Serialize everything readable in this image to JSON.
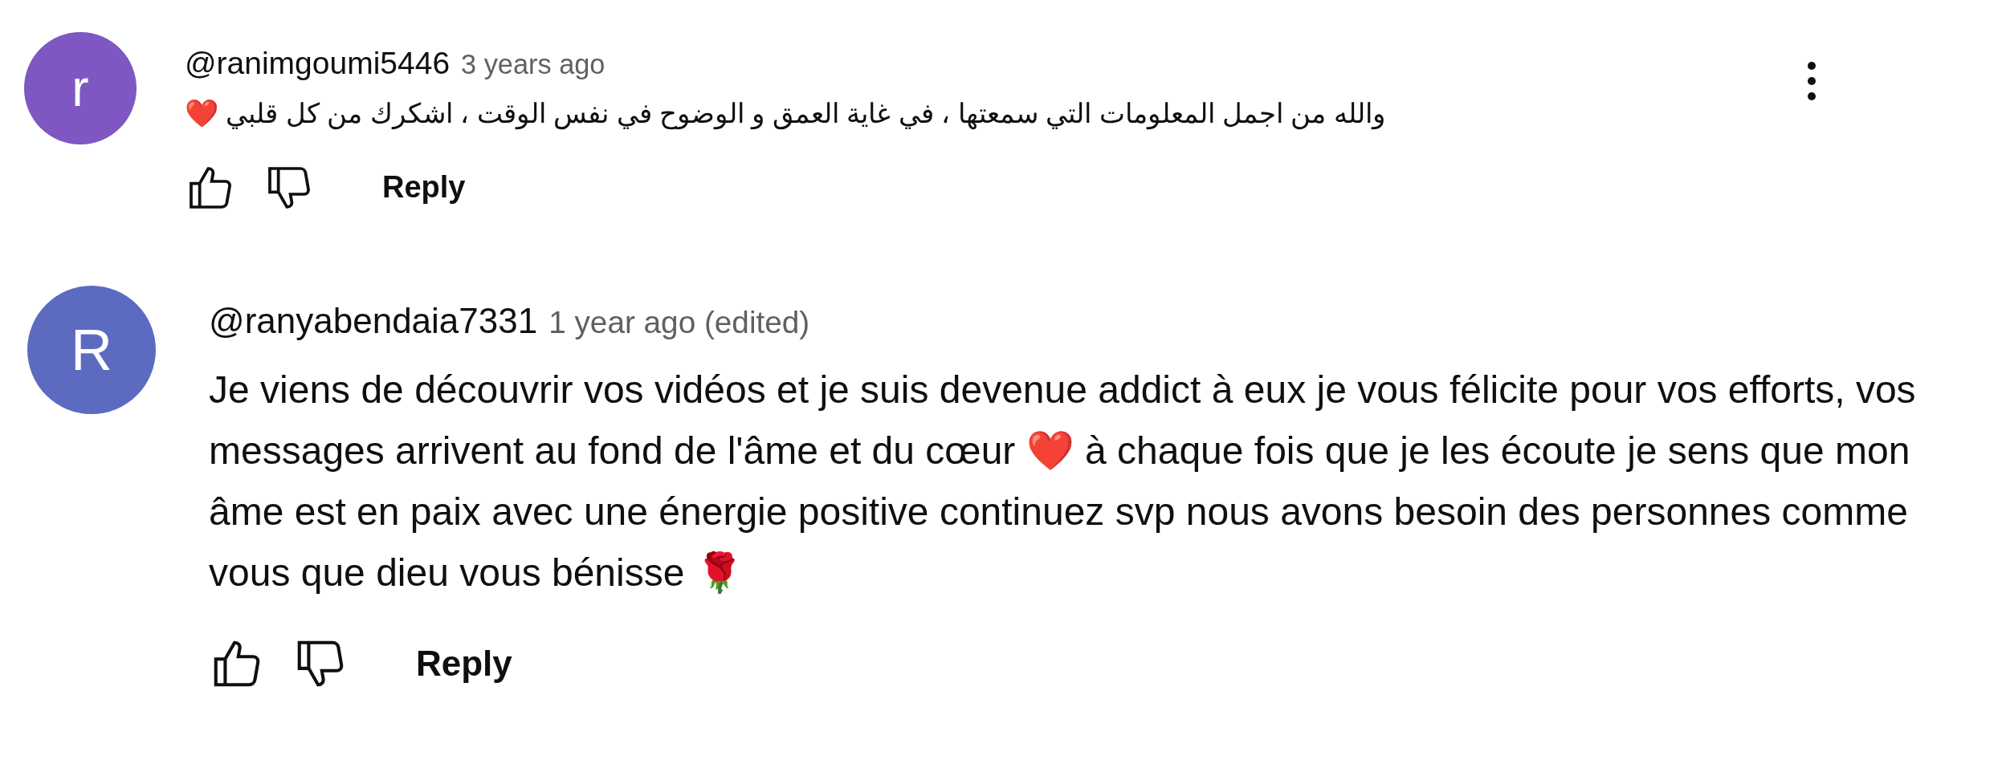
{
  "comments": [
    {
      "avatar_letter": "r",
      "color": "#7e57c2",
      "author": "@ranimgoumi5446",
      "time": "3 years ago",
      "text": "والله من اجمل المعلومات التي سمعتها ، في غاية العمق و الوضوح في نفس الوقت ، اشكرك من كل قلبي ❤️",
      "reply": "Reply",
      "kind": "compact",
      "menu": true
    },
    {
      "avatar_letter": "R",
      "color": "#5c6bc0",
      "author": "@ranyabendaia7331",
      "time": "1 year ago (edited)",
      "text": "Je viens de découvrir vos vidéos et je suis devenue addict à eux je vous félicite pour vos efforts, vos messages arrivent au fond de l'âme et du cœur ❤️  à chaque fois que je les écoute je sens que mon âme est en paix avec une énergie  positive continuez svp nous avons besoin des personnes comme vous que dieu vous bénisse 🌹",
      "reply": "Reply",
      "kind": "large",
      "menu": false
    }
  ]
}
